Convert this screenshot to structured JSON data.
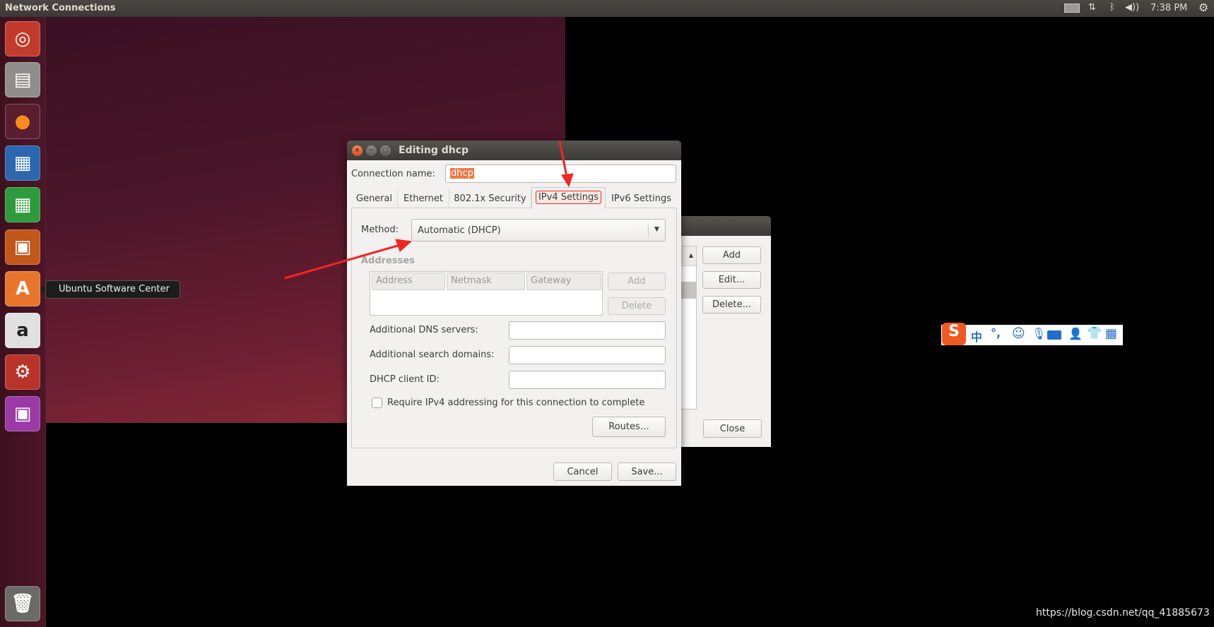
{
  "topbar": {
    "title": "Network Connections",
    "time": "7:38 PM",
    "icons": [
      "keyboard-icon",
      "network-arrows-icon",
      "bluetooth-icon",
      "volume-icon",
      "power-gear-icon"
    ]
  },
  "launcher": {
    "items": [
      {
        "name": "ubuntu-dash",
        "icon": "ubuntu-logo-icon",
        "color": "#c0392b"
      },
      {
        "name": "files",
        "icon": "file-cabinet-icon",
        "color": "#9a9a96"
      },
      {
        "name": "firefox",
        "icon": "firefox-icon",
        "color": "#e66000"
      },
      {
        "name": "libreoffice-writer",
        "icon": "writer-icon",
        "color": "#2a6db0"
      },
      {
        "name": "libreoffice-calc",
        "icon": "calc-icon",
        "color": "#2f9a3c"
      },
      {
        "name": "libreoffice-impress",
        "icon": "impress-icon",
        "color": "#c2571a"
      },
      {
        "name": "ubuntu-software-center",
        "icon": "shopping-bag-icon",
        "color": "#e8752b"
      },
      {
        "name": "amazon",
        "icon": "amazon-icon",
        "color": "#d8d8d8"
      },
      {
        "name": "system-settings",
        "icon": "wrench-gear-icon",
        "color": "#c0392b"
      },
      {
        "name": "network-connections",
        "icon": "network-icon",
        "color": "#9b3aa6"
      }
    ],
    "trash_icon": "trash-icon",
    "tooltip": "Ubuntu Software Center"
  },
  "bg_window": {
    "buttons": {
      "add": "Add",
      "edit": "Edit...",
      "delete": "Delete...",
      "close": "Close"
    }
  },
  "dialog": {
    "title": "Editing dhcp",
    "connection_name_label": "Connection name:",
    "connection_name_value": "dhcp",
    "tabs": [
      {
        "label": "General"
      },
      {
        "label": "Ethernet"
      },
      {
        "label": "802.1x Security"
      },
      {
        "label": "IPv4 Settings",
        "active": true
      },
      {
        "label": "IPv6 Settings"
      }
    ],
    "method_label": "Method:",
    "method_value": "Automatic (DHCP)",
    "addresses_label": "Addresses",
    "columns": [
      "Address",
      "Netmask",
      "Gateway"
    ],
    "add": "Add",
    "delete": "Delete",
    "dns_label": "Additional DNS servers:",
    "dns_value": "",
    "search_label": "Additional search domains:",
    "search_value": "",
    "client_id_label": "DHCP client ID:",
    "client_id_value": "",
    "require_label": "Require IPv4 addressing for this connection to complete",
    "require_checked": false,
    "routes": "Routes…",
    "cancel": "Cancel",
    "save": "Save..."
  },
  "ime_toolbar": {
    "logo": "S",
    "mode": "中",
    "punct": "°,",
    "icons": [
      "emoji-icon",
      "microphone-icon",
      "keyboard-icon",
      "user-card-icon",
      "shirt-skin-icon",
      "grid-tools-icon"
    ]
  },
  "watermark": "https://blog.csdn.net/qq_41885673",
  "annotation_color": "#f0261f"
}
